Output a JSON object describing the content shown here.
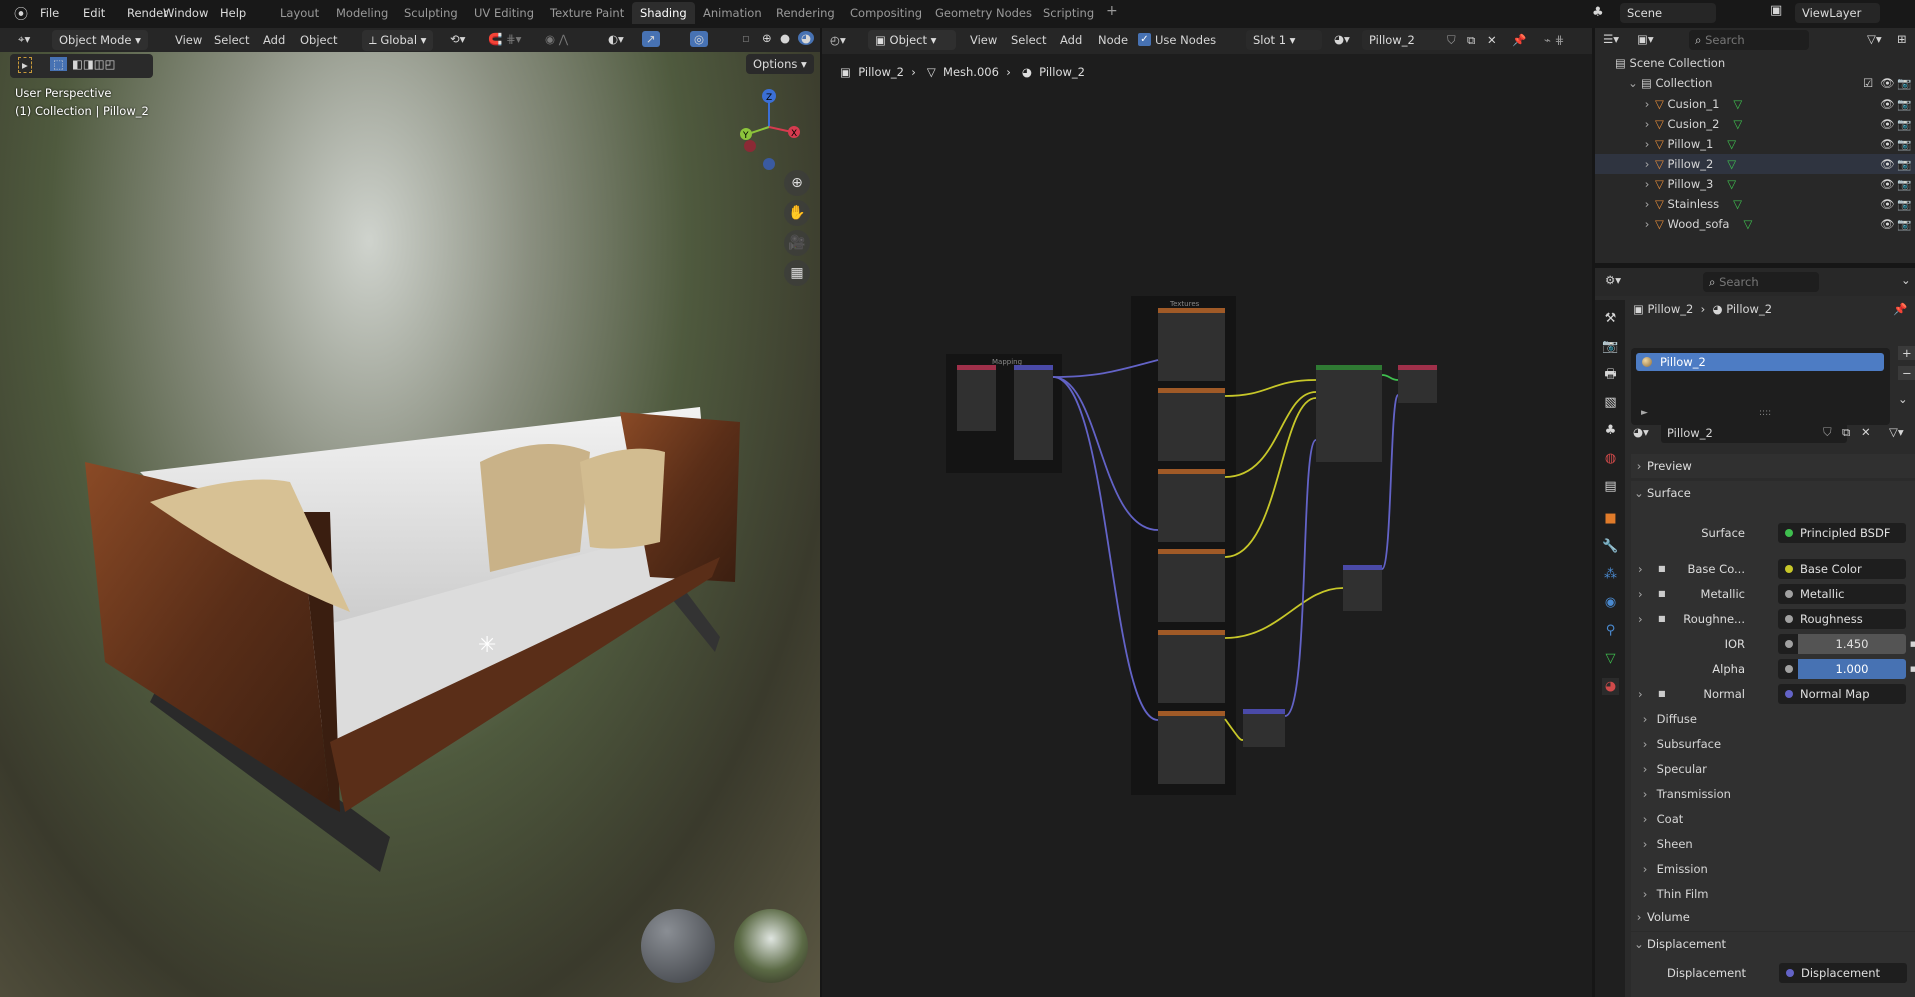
{
  "topbar": {
    "menus": [
      "File",
      "Edit",
      "Render",
      "Window",
      "Help"
    ],
    "workspaces": [
      "Layout",
      "Modeling",
      "Sculpting",
      "UV Editing",
      "Texture Paint",
      "Shading",
      "Animation",
      "Rendering",
      "Compositing",
      "Geometry Nodes",
      "Scripting"
    ],
    "active_workspace": "Shading",
    "add_tab": "+",
    "scene": "Scene",
    "view_layer": "ViewLayer"
  },
  "viewport": {
    "mode": "Object Mode",
    "menus": [
      "View",
      "Select",
      "Add",
      "Object"
    ],
    "orientation": "Global",
    "options": "Options",
    "overlay_line1": "User Perspective",
    "overlay_line2": "(1) Collection | Pillow_2",
    "gizmo": {
      "z": "Z",
      "y": "Y",
      "x": "X"
    }
  },
  "node_editor": {
    "type": "Object",
    "menus": [
      "View",
      "Select",
      "Add",
      "Node"
    ],
    "use_nodes_label": "Use Nodes",
    "use_nodes": true,
    "slot": "Slot 1",
    "material": "Pillow_2",
    "breadcrumb": [
      "Pillow_2",
      "Mesh.006",
      "Pillow_2"
    ],
    "frames": [
      "Mapping",
      "Textures"
    ]
  },
  "outliner": {
    "search_placeholder": "Search",
    "scene_collection": "Scene Collection",
    "collection": "Collection",
    "items": [
      "Cusion_1",
      "Cusion_2",
      "Pillow_1",
      "Pillow_2",
      "Pillow_3",
      "Stainless",
      "Wood_sofa"
    ]
  },
  "properties": {
    "search_placeholder": "Search",
    "breadcrumb": [
      "Pillow_2",
      "Pillow_2"
    ],
    "slot_item": "Pillow_2",
    "material_name": "Pillow_2",
    "sections": {
      "preview": "Preview",
      "surface": "Surface",
      "volume": "Volume",
      "displacement": "Displacement"
    },
    "surface_rows": [
      {
        "label": "Surface",
        "value": "Principled BSDF",
        "color": "#3fbf4f"
      },
      {
        "label": "Base Co...",
        "value": "Base Color",
        "color": "#c7c729"
      },
      {
        "label": "Metallic",
        "value": "Metallic",
        "color": "#a1a1a1"
      },
      {
        "label": "Roughne...",
        "value": "Roughness",
        "color": "#a1a1a1"
      },
      {
        "label": "IOR",
        "value": "1.450",
        "color": "#a1a1a1"
      },
      {
        "label": "Alpha",
        "value": "1.000",
        "color": "#a1a1a1"
      },
      {
        "label": "Normal",
        "value": "Normal Map",
        "color": "#6363c7"
      }
    ],
    "subpanels": [
      "Diffuse",
      "Subsurface",
      "Specular",
      "Transmission",
      "Coat",
      "Sheen",
      "Emission",
      "Thin Film"
    ],
    "displacement_row": {
      "label": "Displacement",
      "value": "Displacement",
      "color": "#6363c7"
    }
  },
  "colors": {
    "accent": "#4772b3",
    "selected": "#4d7cc4",
    "socket_yellow": "#c7c729",
    "socket_grey": "#a1a1a1",
    "socket_purple": "#6363c7",
    "node_texture": "#a05a27",
    "node_bsdf": "#2f7a33"
  }
}
